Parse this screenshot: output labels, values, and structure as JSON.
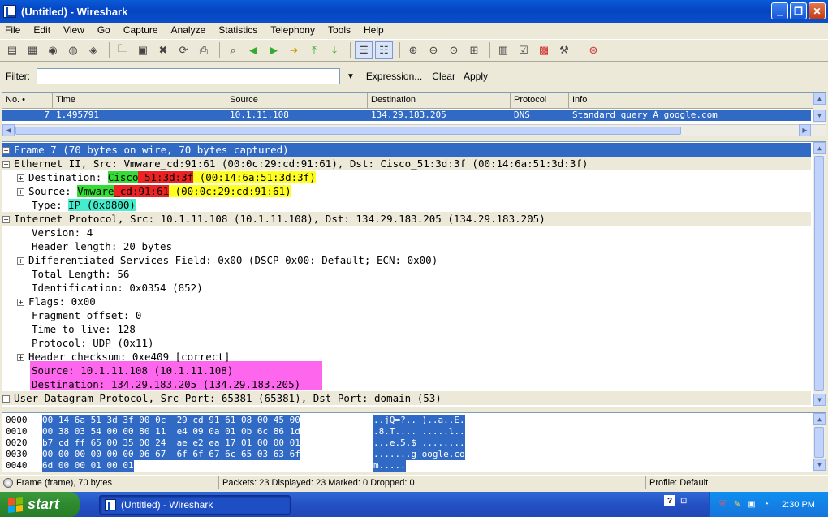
{
  "window": {
    "title": "(Untitled) - Wireshark"
  },
  "menu": [
    "File",
    "Edit",
    "View",
    "Go",
    "Capture",
    "Analyze",
    "Statistics",
    "Telephony",
    "Tools",
    "Help"
  ],
  "filter": {
    "label": "Filter:",
    "value": "",
    "expression": "Expression...",
    "clear": "Clear",
    "apply": "Apply"
  },
  "packet_list": {
    "columns": [
      "No. •",
      "Time",
      "Source",
      "Destination",
      "Protocol",
      "Info"
    ],
    "row": {
      "no": "7",
      "time": "1.495791",
      "source": "10.1.11.108",
      "destination": "134.29.183.205",
      "protocol": "DNS",
      "info": "Standard query A google.com"
    }
  },
  "details": {
    "frame": "Frame 7 (70 bytes on wire, 70 bytes captured)",
    "eth": "Ethernet II, Src: Vmware_cd:91:61 (00:0c:29:cd:91:61), Dst: Cisco_51:3d:3f (00:14:6a:51:3d:3f)",
    "eth_dst_label": "Destination: ",
    "eth_dst_name_a": "Cisco",
    "eth_dst_name_b": "_51:3d:3f",
    "eth_dst_addr": " (00:14:6a:51:3d:3f)",
    "eth_src_label": "Source: ",
    "eth_src_name_a": "Vmware",
    "eth_src_name_b": "_cd:91:61",
    "eth_src_addr": " (00:0c:29:cd:91:61)",
    "eth_type_label": "Type: ",
    "eth_type_val": "IP (0x0800)",
    "ip": "Internet Protocol, Src: 10.1.11.108 (10.1.11.108), Dst: 134.29.183.205 (134.29.183.205)",
    "ip_version": "Version: 4",
    "ip_hlen": "Header length: 20 bytes",
    "ip_dsf": "Differentiated Services Field: 0x00 (DSCP 0x00: Default; ECN: 0x00)",
    "ip_total": "Total Length: 56",
    "ip_id": "Identification: 0x0354 (852)",
    "ip_flags": "Flags: 0x00",
    "ip_frag": "Fragment offset: 0",
    "ip_ttl": "Time to live: 128",
    "ip_proto": "Protocol: UDP (0x11)",
    "ip_checksum": "Header checksum: 0xe409 [correct]",
    "ip_src": "Source: 10.1.11.108 (10.1.11.108)",
    "ip_dst": "Destination: 134.29.183.205 (134.29.183.205)",
    "udp": "User Datagram Protocol, Src Port: 65381 (65381), Dst Port: domain (53)"
  },
  "hex": [
    {
      "offset": "0000",
      "bytes": "00 14 6a 51 3d 3f 00 0c  29 cd 91 61 08 00 45 00",
      "ascii": "..jQ=?.. )..a..E."
    },
    {
      "offset": "0010",
      "bytes": "00 38 03 54 00 00 80 11  e4 09 0a 01 0b 6c 86 1d",
      "ascii": ".8.T.... .....l.."
    },
    {
      "offset": "0020",
      "bytes": "b7 cd ff 65 00 35 00 24  ae e2 ea 17 01 00 00 01",
      "ascii": "...e.5.$ ........"
    },
    {
      "offset": "0030",
      "bytes": "00 00 00 00 00 00 06 67  6f 6f 67 6c 65 03 63 6f",
      "ascii": ".......g oogle.co"
    },
    {
      "offset": "0040",
      "bytes": "6d 00 00 01 00 01",
      "ascii": "m....."
    }
  ],
  "status": {
    "frame": "Frame (frame), 70 bytes",
    "packets": "Packets: 23 Displayed: 23 Marked: 0 Dropped: 0",
    "profile": "Profile: Default"
  },
  "taskbar": {
    "start": "start",
    "task": "(Untitled) - Wireshark",
    "clock": "2:30 PM"
  },
  "colors": {
    "selection": "#316ac5",
    "highlight_green": "#33dd33",
    "highlight_red": "#ee2222",
    "highlight_yellow": "#ffff22",
    "highlight_cyan": "#44eecc",
    "highlight_magenta": "#ff66ee"
  }
}
